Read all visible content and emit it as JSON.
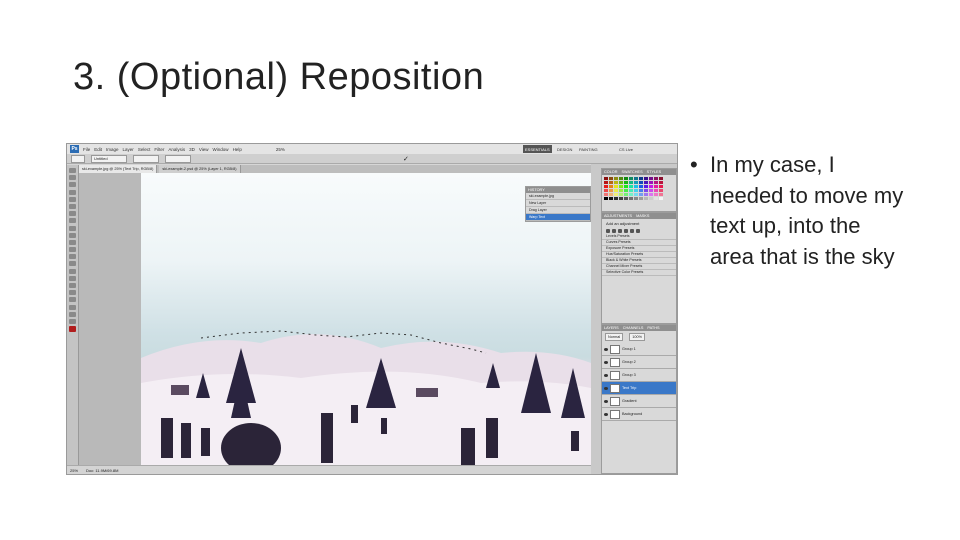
{
  "slide": {
    "title": "3. (Optional) Reposition",
    "bullet": "In my case, I needed to move my text up, into the area that is the sky"
  },
  "photoshop": {
    "logo": "Ps",
    "menu": [
      "File",
      "Edit",
      "Image",
      "Layer",
      "Select",
      "Filter",
      "Analysis",
      "3D",
      "View",
      "Window",
      "Help"
    ],
    "zoom_level": "25%",
    "workspaces": [
      "ESSENTIALS",
      "DESIGN",
      "PAINTING"
    ],
    "cs_live": "CS Live",
    "options": {
      "preset": "Untitled",
      "checkmark": "✓"
    },
    "doc_tabs": [
      "ski-example.jpg @ 25% (Text Trip, RGB/8)",
      "ski-example-2.psd @ 25% (Layer 1, RGB/8)"
    ],
    "status": {
      "zoom": "25%",
      "doc_info": "Doc: 11.9M/69.8M"
    },
    "history": {
      "tab": "HISTORY",
      "rows": [
        "ski-example.jpg",
        "New Layer",
        "Drag Layer",
        "Warp Text"
      ]
    },
    "swatches_tabs": [
      "COLOR",
      "SWATCHES",
      "STYLES"
    ],
    "adjustments": {
      "tabs": [
        "ADJUSTMENTS",
        "MASKS"
      ],
      "label": "Add an adjustment",
      "presets": [
        "Levels Presets",
        "Curves Presets",
        "Exposure Presets",
        "Hue/Saturation Presets",
        "Black & White Presets",
        "Channel Mixer Presets",
        "Selective Color Presets"
      ]
    },
    "layers": {
      "tabs": [
        "LAYERS",
        "CHANNELS",
        "PATHS"
      ],
      "blend_mode": "Normal",
      "opacity": "100%",
      "rows": [
        {
          "name": "Group 1",
          "selected": false
        },
        {
          "name": "Group 2",
          "selected": false
        },
        {
          "name": "Group 3",
          "selected": false
        },
        {
          "name": "Text Trip",
          "selected": true
        },
        {
          "name": "Gradient",
          "selected": false
        },
        {
          "name": "Background",
          "selected": false
        }
      ]
    }
  },
  "colors": {
    "title_text": "#222222",
    "selection_blue": "#3a78c8",
    "foreground_red": "#b11d1d"
  }
}
